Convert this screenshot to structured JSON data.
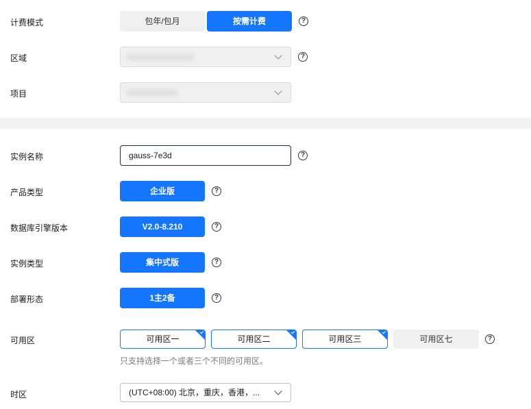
{
  "billing": {
    "label": "计费模式",
    "options": [
      "包年/包月",
      "按需计费"
    ],
    "selected": "按需计费"
  },
  "region": {
    "label": "区域"
  },
  "project": {
    "label": "项目"
  },
  "instance_name": {
    "label": "实例名称",
    "value": "gauss-7e3d"
  },
  "product_type": {
    "label": "产品类型",
    "value": "企业版"
  },
  "db_engine_version": {
    "label": "数据库引擎版本",
    "value": "V2.0-8.210"
  },
  "instance_type": {
    "label": "实例类型",
    "value": "集中式版"
  },
  "deployment": {
    "label": "部署形态",
    "value": "1主2备"
  },
  "az": {
    "label": "可用区",
    "options": [
      {
        "label": "可用区一",
        "selected": true
      },
      {
        "label": "可用区二",
        "selected": true
      },
      {
        "label": "可用区三",
        "selected": true
      },
      {
        "label": "可用区七",
        "selected": false
      }
    ],
    "hint": "只支持选择一个或者三个不同的可用区。"
  },
  "timezone": {
    "label": "时区",
    "value": "(UTC+08:00) 北京，重庆，香港，..."
  },
  "help_glyph": "?",
  "colors": {
    "primary": "#1476ff",
    "divider": "#f3f3f6",
    "muted_bg": "#f0f0f0"
  }
}
